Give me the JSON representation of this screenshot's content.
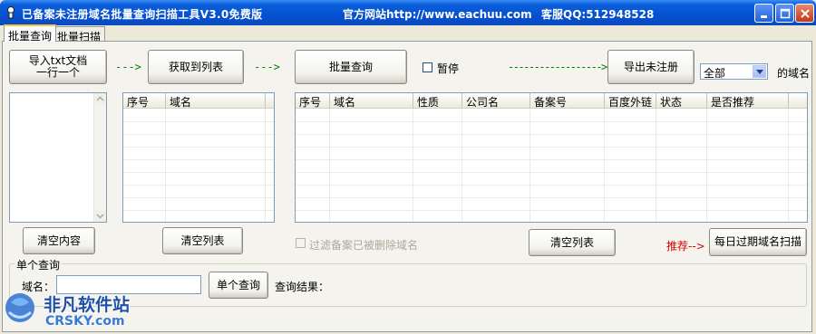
{
  "window": {
    "title": "已备案未注册域名批量查询扫描工具V3.0免费版",
    "site": "官方网站http://www.eachuu.com",
    "qq": "客服QQ:512948528"
  },
  "tabs": [
    {
      "label": "批量查询",
      "active": true
    },
    {
      "label": "批量扫描",
      "active": false
    }
  ],
  "toolbar": {
    "import_line1": "导入txt文档",
    "import_line2": "一行一个",
    "arrow1": "--->",
    "fetch_label": "获取到列表",
    "arrow2": "--->",
    "batch_query_label": "批量查询",
    "pause_label": "暂停",
    "arrow3": "------------------>",
    "export_label": "导出未注册",
    "filter_selected": "全部",
    "domain_suffix_label": "的域名"
  },
  "left_list": {
    "columns": [
      "序号",
      "域名"
    ]
  },
  "result_list": {
    "columns": [
      "序号",
      "域名",
      "性质",
      "公司名",
      "备案号",
      "百度外链",
      "状态",
      "是否推荐"
    ]
  },
  "bottom_buttons": {
    "clear_content": "清空内容",
    "clear_list_left": "清空列表",
    "filter_deleted_label": "过滤备案已被删除域名",
    "clear_list_right": "清空列表",
    "recommend_label": "推荐-->",
    "daily_expired_scan": "每日过期域名扫描"
  },
  "single_query": {
    "group_title": "单个查询",
    "domain_label": "域名：",
    "domain_value": "",
    "button_label": "单个查询",
    "result_label": "查询结果："
  },
  "watermark": {
    "text_cn": "非凡软件站",
    "text_en": "CRSKY.com"
  },
  "colors": {
    "titlebar": "#0651d0",
    "arrow_green": "#008000",
    "recommend_red": "#e00000",
    "window_bg": "#ece9d8"
  }
}
